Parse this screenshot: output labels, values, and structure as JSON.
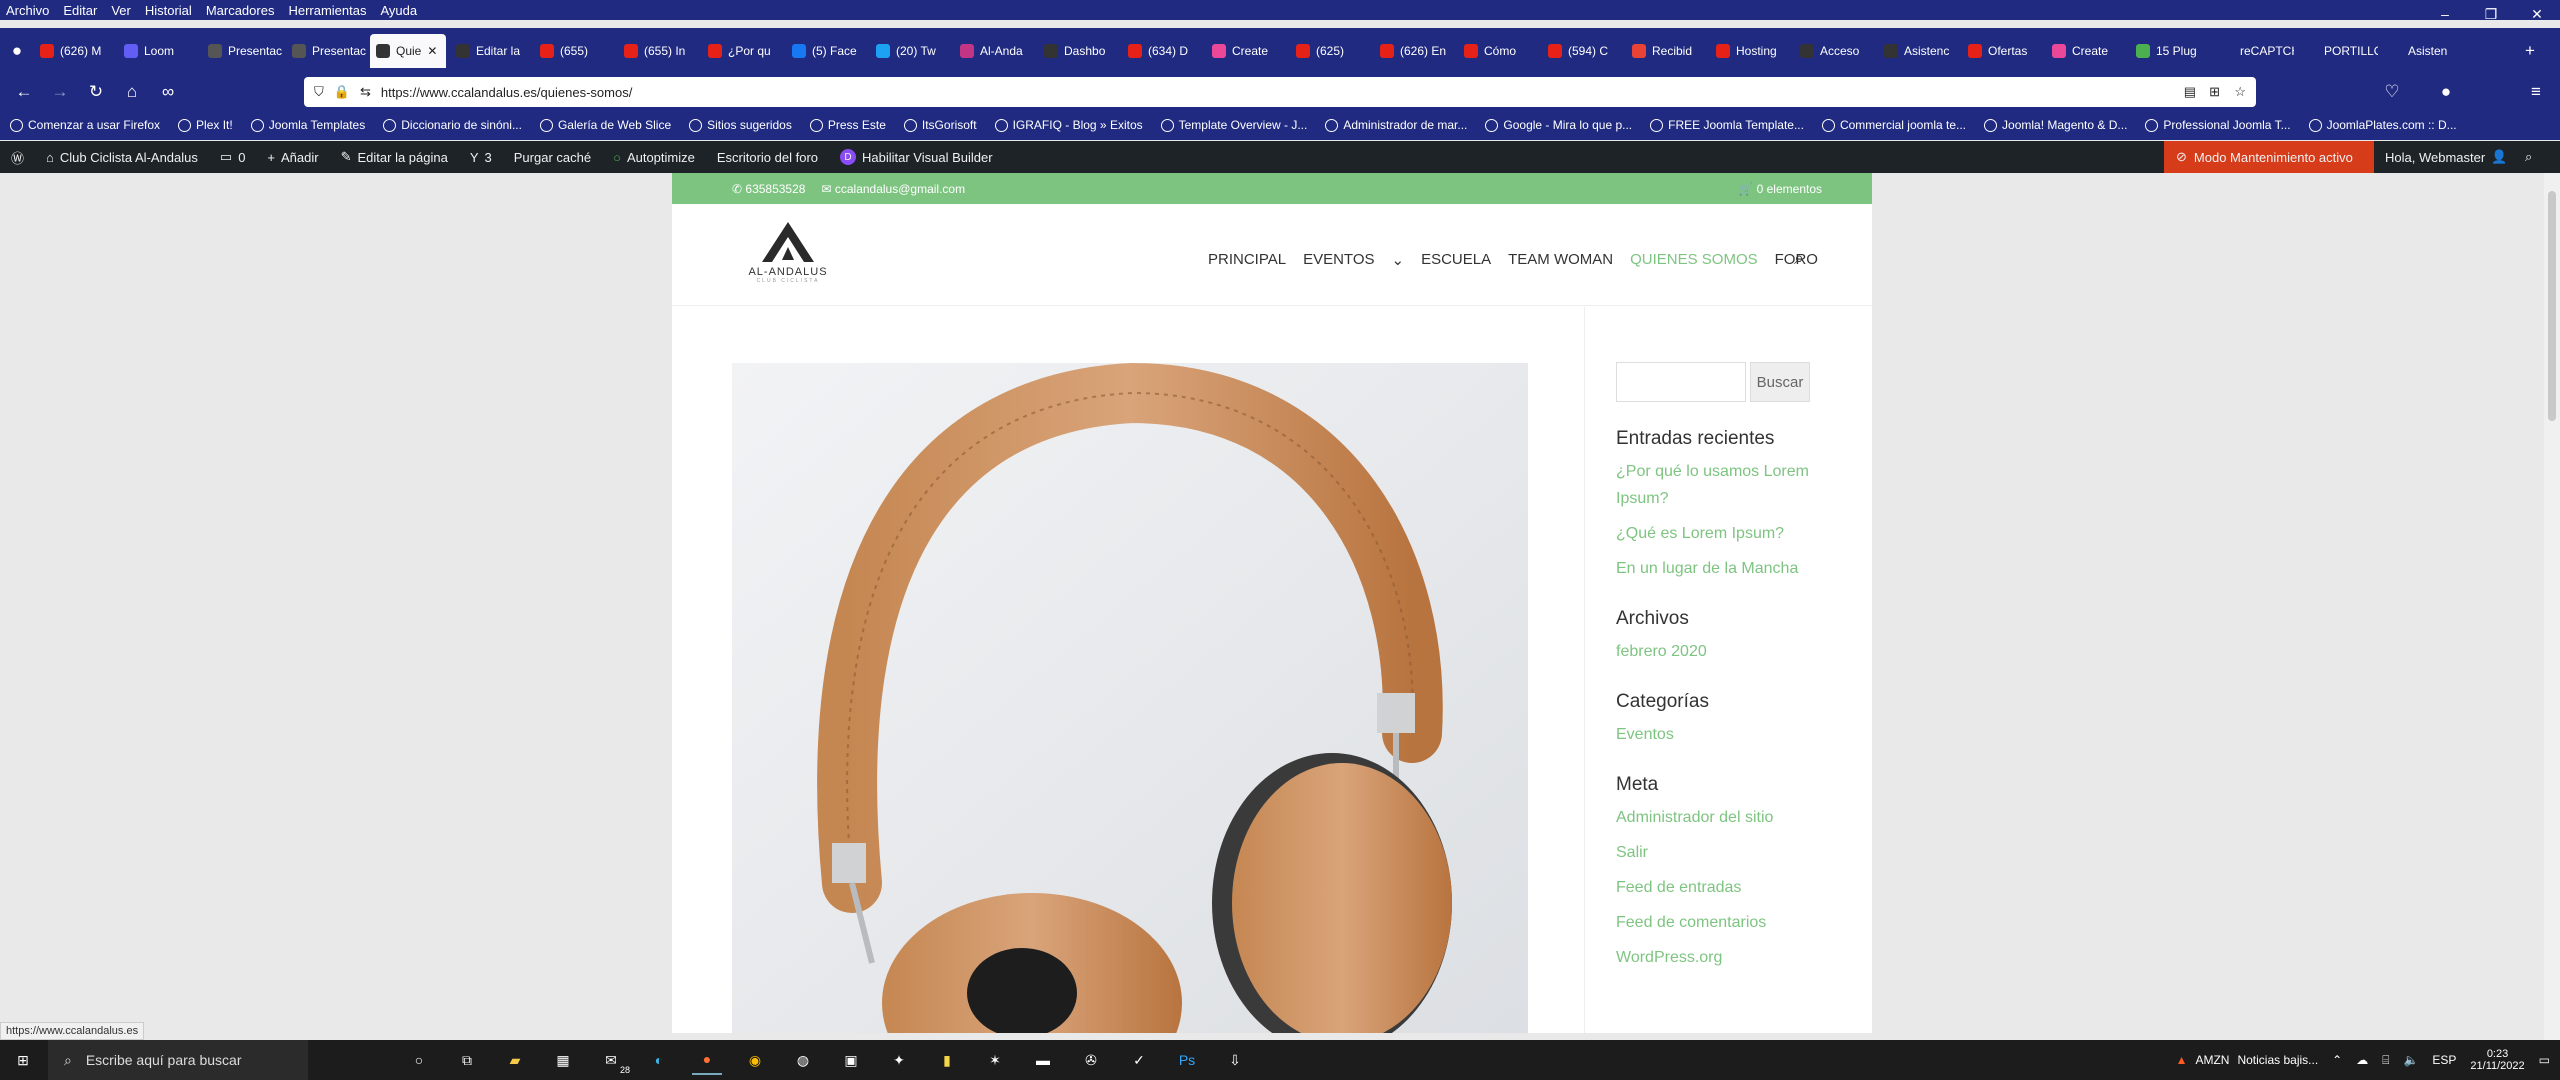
{
  "menubar": [
    "Archivo",
    "Editar",
    "Ver",
    "Historial",
    "Marcadores",
    "Herramientas",
    "Ayuda"
  ],
  "tabs": [
    {
      "label": "(626) M",
      "color": "#e62117"
    },
    {
      "label": "Loom",
      "color": "#625df5"
    },
    {
      "label": "Presentació",
      "color": "#555"
    },
    {
      "label": "Presentació",
      "color": "#555"
    },
    {
      "label": "Quie",
      "color": "#333",
      "active": true
    },
    {
      "label": "Editar la",
      "color": "#333"
    },
    {
      "label": "(655)",
      "color": "#e62117"
    },
    {
      "label": "(655) In",
      "color": "#e62117"
    },
    {
      "label": "¿Por qu",
      "color": "#e62117"
    },
    {
      "label": "(5) Face",
      "color": "#1877f2"
    },
    {
      "label": "(20) Tw",
      "color": "#1da1f2"
    },
    {
      "label": "Al-Anda",
      "color": "#c13584"
    },
    {
      "label": "Dashbo",
      "color": "#333"
    },
    {
      "label": "(634) D",
      "color": "#e62117"
    },
    {
      "label": "Create",
      "color": "#ec4899"
    },
    {
      "label": "(625)",
      "color": "#e62117"
    },
    {
      "label": "(626) En",
      "color": "#e62117"
    },
    {
      "label": "Cómo",
      "color": "#e62117"
    },
    {
      "label": "(594) C",
      "color": "#e62117"
    },
    {
      "label": "Recibid",
      "color": "#ea4335"
    },
    {
      "label": "Hosting",
      "color": "#e62117"
    },
    {
      "label": "Acceso",
      "color": "#333"
    },
    {
      "label": "Asistenc",
      "color": "#333"
    },
    {
      "label": "Ofertas",
      "color": "#e62117"
    },
    {
      "label": "Create",
      "color": "#ec4899"
    },
    {
      "label": "15 Plug",
      "color": "#4caf50"
    },
    {
      "label": "reCAPTCHA",
      "color": "#1f2a80"
    },
    {
      "label": "PORTILLO",
      "color": "#1f2a80"
    },
    {
      "label": "Asisten",
      "color": "#1f2a80"
    }
  ],
  "url": "https://www.ccalandalus.es/quienes-somos/",
  "bookmarks": [
    "Comenzar a usar Firefox",
    "Plex It!",
    "Joomla Templates",
    "Diccionario de sinóni...",
    "Galería de Web Slice",
    "Sitios sugeridos",
    "Press Este",
    "ItsGorisoft",
    "IGRAFIQ - Blog » Exitos",
    "Template Overview - J...",
    "Administrador de mar...",
    "Google - Mira lo que p...",
    "FREE Joomla Template...",
    "Commercial joomla te...",
    "Joomla! Magento & D...",
    "Professional Joomla T...",
    "JoomlaPlates.com :: D..."
  ],
  "wpbar": {
    "site": "Club Ciclista Al-Andalus",
    "comments": "0",
    "add": "Añadir",
    "edit": "Editar la página",
    "yoast": "3",
    "purge": "Purgar caché",
    "autoptimize": "Autoptimize",
    "forum": "Escritorio del foro",
    "divi": "Habilitar Visual Builder",
    "maint": "Modo Mantenimiento activo",
    "greeting": "Hola, Webmaster"
  },
  "site": {
    "phone": "635853528",
    "email": "ccalandalus@gmail.com",
    "cart": "0 elementos",
    "logo": "AL-ANDALUS",
    "logo_sub": "CLUB CICLISTA",
    "menu": [
      "PRINCIPAL",
      "EVENTOS",
      "ESCUELA",
      "TEAM WOMAN",
      "QUIENES SOMOS",
      "FORO"
    ]
  },
  "sidebar": {
    "search_btn": "Buscar",
    "recent_title": "Entradas recientes",
    "recent": [
      "¿Por qué lo usamos Lorem Ipsum?",
      "¿Qué es Lorem Ipsum?",
      "En un lugar de la Mancha"
    ],
    "archives_title": "Archivos",
    "archives": [
      "febrero 2020"
    ],
    "cats_title": "Categorías",
    "cats": [
      "Eventos"
    ],
    "meta_title": "Meta",
    "meta": [
      "Administrador del sitio",
      "Salir",
      "Feed de entradas",
      "Feed de comentarios",
      "WordPress.org"
    ]
  },
  "status_url": "https://www.ccalandalus.es",
  "taskbar": {
    "search": "Escribe aquí para buscar",
    "mail_badge": "28",
    "stock": "AMZN",
    "news": "Noticias bajis...",
    "lang": "ESP",
    "time": "0:23",
    "date": "21/11/2022"
  }
}
